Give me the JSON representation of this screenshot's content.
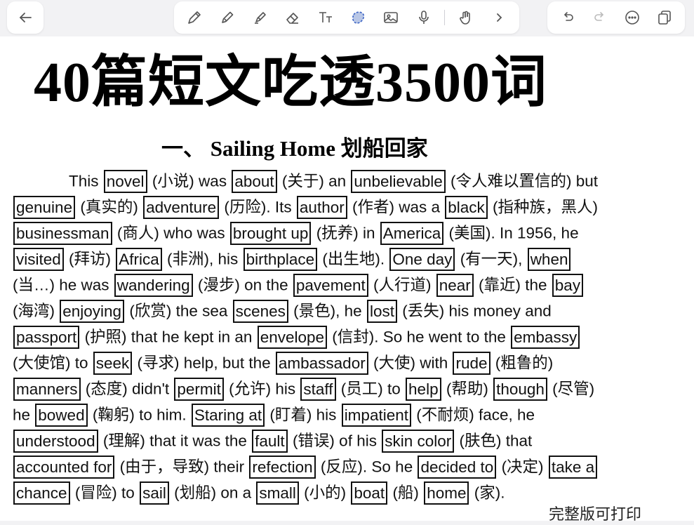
{
  "toolbar": {
    "back_icon": "back-arrow-icon",
    "tools": [
      "pen-icon",
      "pencil-icon",
      "highlighter-icon",
      "eraser-icon",
      "text-tool-icon",
      "lasso-icon",
      "image-icon",
      "microphone-icon",
      "hand-pointer-icon",
      "chevron-right-icon"
    ],
    "right": [
      "undo-icon",
      "redo-icon",
      "more-icon",
      "pages-icon"
    ]
  },
  "document": {
    "main_title": "40篇短文吃透3500词",
    "section_title": "一、 Sailing Home  划船回家",
    "footer_note": "完整版可打印",
    "lines": [
      [
        {
          "t": "This "
        },
        {
          "w": "novel"
        },
        {
          "t": " (小说) was "
        },
        {
          "w": "about"
        },
        {
          "t": " (关于) an "
        },
        {
          "w": "unbelievable"
        },
        {
          "t": " (令人难以置信的) but"
        }
      ],
      [
        {
          "w": "genuine"
        },
        {
          "t": " (真实的) "
        },
        {
          "w": "adventure"
        },
        {
          "t": " (历险). Its "
        },
        {
          "w": "author"
        },
        {
          "t": " (作者) was a "
        },
        {
          "w": "black"
        },
        {
          "t": " (指种族，黑人)"
        }
      ],
      [
        {
          "w": "businessman"
        },
        {
          "t": " (商人) who was "
        },
        {
          "w": "brought up"
        },
        {
          "t": " (抚养) in "
        },
        {
          "w": "America"
        },
        {
          "t": " (美国). In 1956, he"
        }
      ],
      [
        {
          "w": "visited"
        },
        {
          "t": " (拜访) "
        },
        {
          "w": "Africa"
        },
        {
          "t": " (非洲), his "
        },
        {
          "w": "birthplace"
        },
        {
          "t": " (出生地). "
        },
        {
          "w": "One day"
        },
        {
          "t": " (有一天), "
        },
        {
          "w": "when"
        }
      ],
      [
        {
          "t": "(当…) he was "
        },
        {
          "w": "wandering"
        },
        {
          "t": " (漫步) on the "
        },
        {
          "w": "pavement"
        },
        {
          "t": " (人行道) "
        },
        {
          "w": "near"
        },
        {
          "t": " (靠近) the "
        },
        {
          "w": "bay"
        }
      ],
      [
        {
          "t": "(海湾) "
        },
        {
          "w": "enjoying"
        },
        {
          "t": " (欣赏) the sea "
        },
        {
          "w": "scenes"
        },
        {
          "t": " (景色), he "
        },
        {
          "w": "lost"
        },
        {
          "t": " (丢失) his money and"
        }
      ],
      [
        {
          "w": "passport"
        },
        {
          "t": " (护照) that he kept in an "
        },
        {
          "w": "envelope"
        },
        {
          "t": " (信封). So he went to the "
        },
        {
          "w": "embassy"
        }
      ],
      [
        {
          "t": "(大使馆) to "
        },
        {
          "w": "seek"
        },
        {
          "t": " (寻求) help, but the "
        },
        {
          "w": "ambassador"
        },
        {
          "t": " (大使) with "
        },
        {
          "w": "rude"
        },
        {
          "t": " (粗鲁的)"
        }
      ],
      [
        {
          "w": "manners"
        },
        {
          "t": " (态度) didn't "
        },
        {
          "w": "permit"
        },
        {
          "t": " (允许) his "
        },
        {
          "w": "staff"
        },
        {
          "t": " (员工) to "
        },
        {
          "w": "help"
        },
        {
          "t": " (帮助) "
        },
        {
          "w": "though"
        },
        {
          "t": " (尽管)"
        }
      ],
      [
        {
          "t": "he "
        },
        {
          "w": "bowed"
        },
        {
          "t": " (鞠躬) to him. "
        },
        {
          "w": "Staring at"
        },
        {
          "t": " (盯着) his "
        },
        {
          "w": "impatient"
        },
        {
          "t": " (不耐烦) face, he"
        }
      ],
      [
        {
          "w": "understood"
        },
        {
          "t": " (理解) that it was the "
        },
        {
          "w": "fault"
        },
        {
          "t": " (错误) of his "
        },
        {
          "w": "skin color"
        },
        {
          "t": " (肤色) that"
        }
      ],
      [
        {
          "w": "accounted for"
        },
        {
          "t": " (由于，导致) their "
        },
        {
          "w": "refection"
        },
        {
          "t": " (反应). So he "
        },
        {
          "w": "decided to"
        },
        {
          "t": " (决定) "
        },
        {
          "w": "take a"
        }
      ],
      [
        {
          "w": "chance"
        },
        {
          "t": " (冒险) to "
        },
        {
          "w": "sail"
        },
        {
          "t": " (划船) on a "
        },
        {
          "w": "small"
        },
        {
          "t": " (小的) "
        },
        {
          "w": "boat"
        },
        {
          "t": " (船) "
        },
        {
          "w": "home"
        },
        {
          "t": " (家)."
        }
      ]
    ]
  }
}
